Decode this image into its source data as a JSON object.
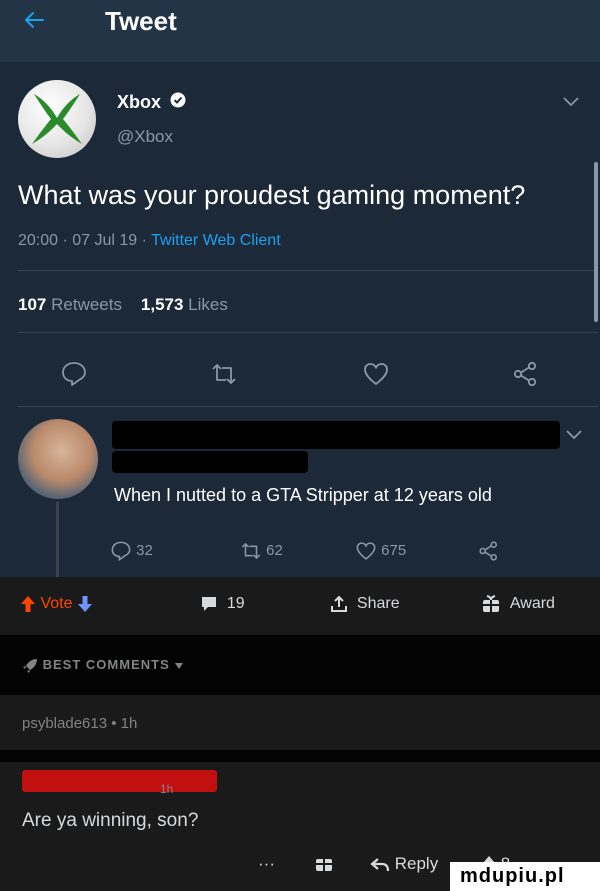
{
  "header": {
    "title": "Tweet",
    "back_icon": "back-arrow-icon"
  },
  "tweet": {
    "author_name": "Xbox",
    "author_handle": "@Xbox",
    "text": "What was your proudest gaming moment?",
    "timestamp": "20:00 · 07 Jul 19 · ",
    "client": "Twitter Web Client",
    "retweet_count": "107",
    "retweet_label": "Retweets",
    "like_count": "1,573",
    "like_label": "Likes",
    "actions": [
      "reply-icon",
      "retweet-icon",
      "like-icon",
      "share-icon"
    ]
  },
  "reply": {
    "text": "When I nutted to a GTA Stripper at 12 years old",
    "reply_count": "32",
    "retweet_count": "62",
    "like_count": "675"
  },
  "post_bar": {
    "vote_label": "Vote",
    "comment_count": "19",
    "share_label": "Share",
    "award_label": "Award"
  },
  "comments": {
    "sort_label": "BEST COMMENTS",
    "first_meta": "psyblade613 • 1h",
    "second_time": "1h",
    "second_text": "Are ya winning, son?",
    "more_label": "···",
    "reply_label": "Reply",
    "vote_count": "8"
  },
  "watermark": {
    "text": "mdupiu.pl"
  },
  "colors": {
    "twitter_bg": "#1c2938",
    "twitter_link": "#1da1f2",
    "reddit_bg": "#1a1a1b",
    "upvote": "#ff4500",
    "downvote": "#7193ff"
  }
}
